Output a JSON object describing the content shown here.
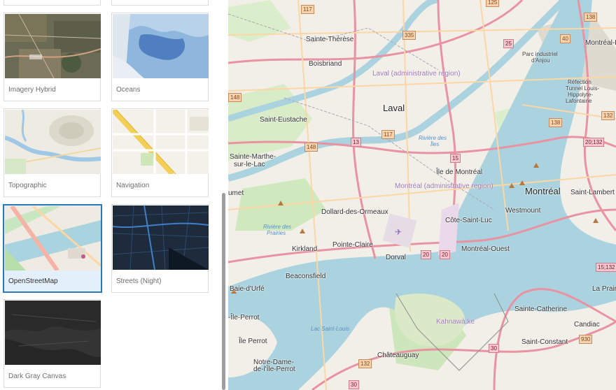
{
  "gallery": {
    "cards": [
      {
        "label": "Imagery Hybrid",
        "selected": false
      },
      {
        "label": "Oceans",
        "selected": false
      },
      {
        "label": "Topographic",
        "selected": false
      },
      {
        "label": "Navigation",
        "selected": false
      },
      {
        "label": "OpenStreetMap",
        "selected": true
      },
      {
        "label": "Streets (Night)",
        "selected": false
      },
      {
        "label": "Dark Gray Canvas",
        "selected": false
      }
    ]
  },
  "map": {
    "places": {
      "sainte_therese": "Sainte-Thérèse",
      "boisbriand": "Boisbriand",
      "laval_region": "Laval (administrative region)",
      "laval": "Laval",
      "parc_industriel": "Parc industriel",
      "d_anjou": "d'Anjou",
      "montreal_est": "Montréal-Est",
      "refection": "Réfection",
      "tunnel": "Tunnel Louis-",
      "hippolyte": "Hippolyte-",
      "lafontaine": "Lafontaine",
      "saint_eustache": "Saint-Eustache",
      "riviere_iles_1": "Rivière des",
      "riviere_iles_2": "Îles",
      "sainte_marthe_1": "Sainte-Marthe-",
      "sainte_marthe_2": "sur-le-Lac",
      "ile_de_montreal": "Île de Montréal",
      "montreal_region": "Montréal (administrative region)",
      "montreal": "Montréal",
      "saint_lambert": "Saint-Lambert",
      "westmount": "Westmount",
      "umet": "umet",
      "dollard": "Dollard-des-Ormeaux",
      "riviere_prairies_1": "Rivière des",
      "riviere_prairies_2": "Prairies",
      "cote_saint_luc": "Côte-Saint-Luc",
      "kirkland": "Kirkland",
      "pointe_claire": "Pointe-Claire",
      "montreal_ouest": "Montréal-Ouest",
      "dorval": "Dorval",
      "beaconsfield": "Beaconsfield",
      "baie_durfe": "Baie-d'Urfé",
      "la_prairie": "La Prairie",
      "ile_perrot_1": "-Île-Perrot",
      "ile_perrot_2": "Île Perrot",
      "lac_saint_louis": "Lac Saint-Louis",
      "kahnawake": "Kahnawà:ke",
      "sainte_catherine": "Sainte-Catherine",
      "candiac": "Candiac",
      "saint_constant": "Saint-Constant",
      "notre_dame_1": "Notre-Dame-",
      "notre_dame_2": "de-l'Île-Perrot",
      "chateauguay": "Châteauguay"
    },
    "shields": {
      "r117_top": "117",
      "r125": "125",
      "r138_top": "138",
      "r335": "335",
      "r25_top": "25",
      "r40": "40",
      "r148_left": "148",
      "r117_mid": "117",
      "r148_mid": "148",
      "r13": "13",
      "r15": "15",
      "r138_mid": "138",
      "r132_right": "132",
      "r20_132": "20;132",
      "r20_a": "20",
      "r20_b": "20",
      "r15_132": "15;132",
      "r930": "930",
      "r30_a": "30",
      "r132_bottom": "132",
      "r30_b": "30"
    }
  },
  "colors": {
    "selected_border": "#2a7ab8",
    "selected_bg": "#e3f0fb",
    "water": "#aad3df",
    "motorway": "#e892a2",
    "primary_road": "#fcd6a4",
    "park": "#c8facc"
  }
}
